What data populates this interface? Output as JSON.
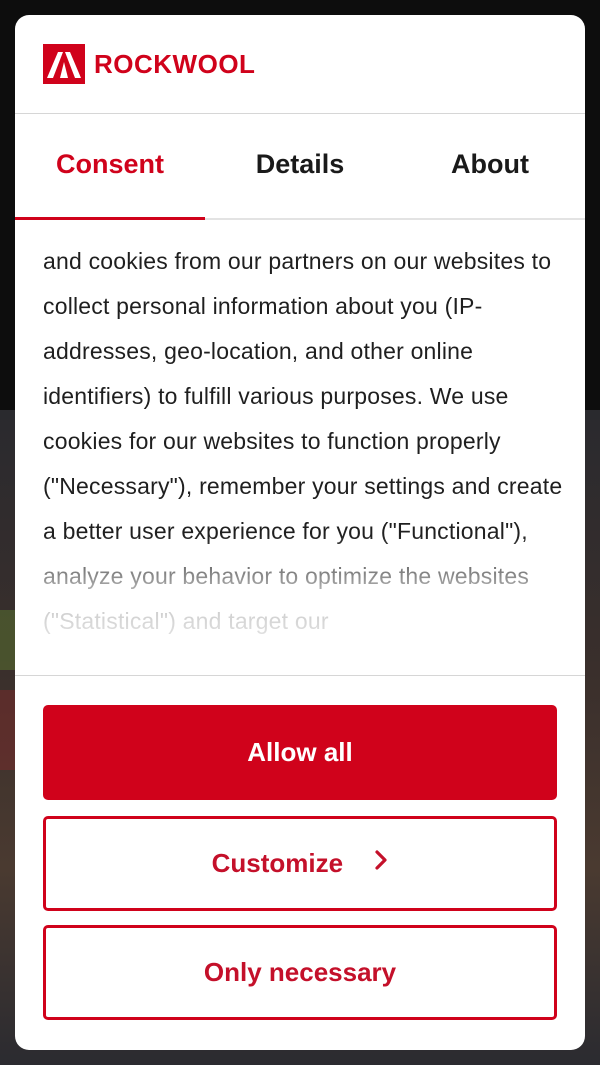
{
  "brand": {
    "name": "ROCKWOOL",
    "color": "#d0021b"
  },
  "tabs": [
    {
      "label": "Consent",
      "active": true
    },
    {
      "label": "Details",
      "active": false
    },
    {
      "label": "About",
      "active": false
    }
  ],
  "body": {
    "text": "and cookies from our partners on our websites to collect personal information about you (IP-addresses, geo-location, and other online identifiers) to fulfill various purposes. We use cookies for our websites to function properly (\"Necessary\"), remember your settings and create a better user experience for you (\"Functional\"), analyze your behavior to optimize the websites (\"Statistical\") and target our"
  },
  "buttons": {
    "allow_all": "Allow all",
    "customize": "Customize",
    "only_necessary": "Only necessary"
  },
  "icons": {
    "customize": "chevron-right-icon",
    "logo": "rockwool-logo-icon"
  }
}
